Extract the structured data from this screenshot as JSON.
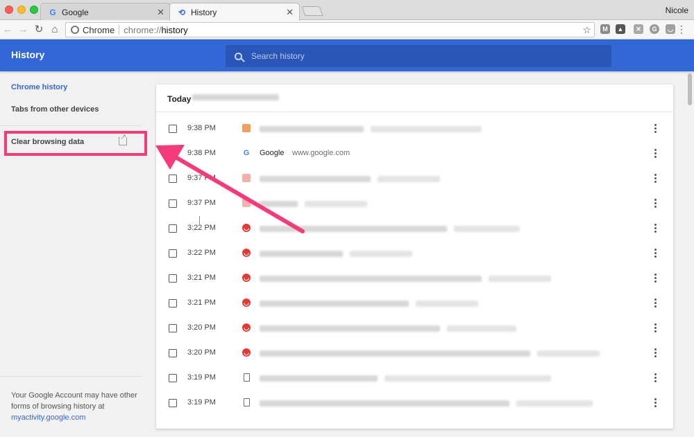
{
  "window": {
    "profile_name": "Nicole",
    "tabs": [
      {
        "title": "Google",
        "favicon": "G",
        "active": false
      },
      {
        "title": "History",
        "favicon": "history-icon",
        "active": true
      }
    ]
  },
  "toolbar": {
    "omnibox_label": "Chrome",
    "url_scheme": "chrome://",
    "url_path": "history"
  },
  "header": {
    "title": "History",
    "search_placeholder": "Search history"
  },
  "sidebar": {
    "chrome_history": "Chrome history",
    "tabs_from_other_devices": "Tabs from other devices",
    "clear_browsing_data": "Clear browsing data",
    "footer_text": "Your Google Account may have other forms of browsing history at",
    "footer_link": "myactivity.google.com"
  },
  "history": {
    "day_label": "Today",
    "entries": [
      {
        "time": "9:38 PM",
        "icon": "orange-site-icon",
        "title": "",
        "domain": ""
      },
      {
        "time": "9:38 PM",
        "icon": "google-icon",
        "title": "Google",
        "domain": "www.google.com"
      },
      {
        "time": "9:37 PM",
        "icon": "red-site-icon",
        "title": "",
        "domain": ""
      },
      {
        "time": "9:37 PM",
        "icon": "red-site-icon",
        "title": "",
        "domain": ""
      },
      {
        "time": "3:22 PM",
        "icon": "red-circle-icon",
        "title": "",
        "domain": ""
      },
      {
        "time": "3:22 PM",
        "icon": "red-circle-icon",
        "title": "",
        "domain": ""
      },
      {
        "time": "3:21 PM",
        "icon": "red-circle-icon",
        "title": "",
        "domain": ""
      },
      {
        "time": "3:21 PM",
        "icon": "red-circle-icon",
        "title": "",
        "domain": ""
      },
      {
        "time": "3:20 PM",
        "icon": "red-circle-icon",
        "title": "",
        "domain": ""
      },
      {
        "time": "3:20 PM",
        "icon": "red-circle-icon",
        "title": "",
        "domain": ""
      },
      {
        "time": "3:19 PM",
        "icon": "document-icon",
        "title": "",
        "domain": ""
      },
      {
        "time": "3:19 PM",
        "icon": "document-icon",
        "title": "",
        "domain": ""
      }
    ]
  },
  "colors": {
    "header_blue": "#3367d6",
    "highlight_pink": "#f53b7b"
  }
}
